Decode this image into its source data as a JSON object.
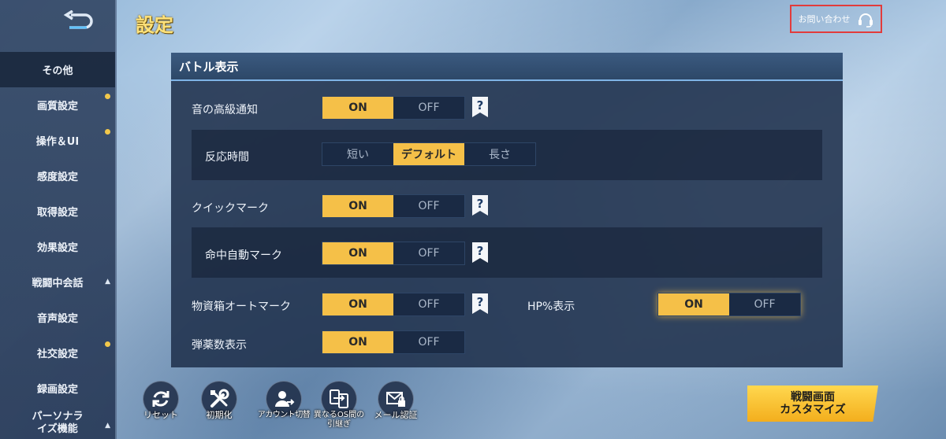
{
  "header": {
    "title": "設定",
    "contact_label": "お問い合わせ"
  },
  "sidebar": {
    "items": [
      {
        "label": "その他",
        "active": true
      },
      {
        "label": "画質設定",
        "dot": true
      },
      {
        "label": "操作＆UI",
        "dot": true
      },
      {
        "label": "感度設定"
      },
      {
        "label": "取得設定"
      },
      {
        "label": "効果設定"
      },
      {
        "label": "戦闘中会話",
        "expand": "▲"
      },
      {
        "label": "音声設定"
      },
      {
        "label": "社交設定",
        "dot": true
      },
      {
        "label": "録画設定"
      },
      {
        "label": "パーソナライズ機能",
        "line1": "パーソナラ",
        "line2": "イズ機能",
        "expand": "▲"
      }
    ]
  },
  "panel": {
    "title": "バトル表示",
    "rows": {
      "sound": {
        "label": "音の高級通知",
        "on": "ON",
        "off": "OFF",
        "selected": "ON"
      },
      "reaction": {
        "label": "反応時間",
        "options": [
          "短い",
          "デフォルト",
          "長さ"
        ],
        "selected": "デフォルト"
      },
      "quickmark": {
        "label": "クイックマーク",
        "on": "ON",
        "off": "OFF",
        "selected": "ON"
      },
      "hitmark": {
        "label": "命中自動マーク",
        "on": "ON",
        "off": "OFF",
        "selected": "ON"
      },
      "supply": {
        "label": "物資箱オートマーク",
        "on": "ON",
        "off": "OFF",
        "selected": "ON"
      },
      "hp": {
        "label": "HP%表示",
        "on": "ON",
        "off": "OFF",
        "selected": "ON"
      },
      "ammo": {
        "label": "弾薬数表示",
        "on": "ON",
        "off": "OFF",
        "selected": "ON"
      }
    },
    "help_glyph": "?"
  },
  "bottom": {
    "reset": "リセット",
    "init": "初期化",
    "account": "アカウント切替",
    "transfer_line1": "異なるOS間の",
    "transfer_line2": "引継ぎ",
    "mail": "メール認証",
    "customize_line1": "戦闘画面",
    "customize_line2": "カスタマイズ"
  },
  "colors": {
    "accent": "#f5c048",
    "title": "#ffe27a",
    "panel": "#223450",
    "highlight_border": "#e23b3b"
  }
}
